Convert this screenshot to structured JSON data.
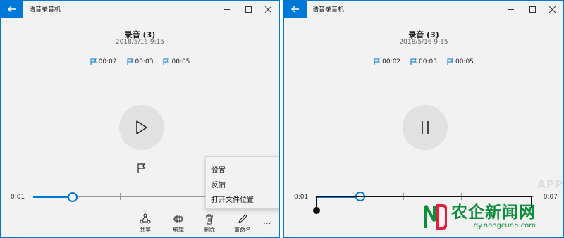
{
  "app": {
    "title": "语音录音机",
    "back_icon": "back-arrow-icon",
    "accent": "#0078d7"
  },
  "left_window": {
    "recording_title": "录音 (3)",
    "recording_date": "2018/5/16 9:15",
    "markers": [
      "00:02",
      "00:03",
      "00:05"
    ],
    "state": "paused",
    "play_icon": "play-icon",
    "add_marker_icon": "flag-icon",
    "time_start": "0:01",
    "progress_fraction": 0.2,
    "commands": [
      {
        "label": "共享",
        "icon": "share-icon"
      },
      {
        "label": "剪辑",
        "icon": "trim-icon"
      },
      {
        "label": "删除",
        "icon": "delete-icon"
      },
      {
        "label": "重命名",
        "icon": "rename-icon"
      }
    ],
    "more_label": "...",
    "context_menu": [
      "设置",
      "反馈",
      "打开文件位置"
    ]
  },
  "right_window": {
    "recording_title": "录音 (3)",
    "recording_date": "2018/5/16 9:15",
    "markers": [
      "00:02",
      "00:03",
      "00:05"
    ],
    "state": "playing",
    "pause_icon": "pause-icon",
    "time_start": "0:01",
    "time_end": "0:07",
    "progress_fraction": 0.2
  },
  "watermarks": {
    "app": "APP",
    "site_main": "农企新闻网",
    "site_sub": "qy.nongcun5.com"
  }
}
